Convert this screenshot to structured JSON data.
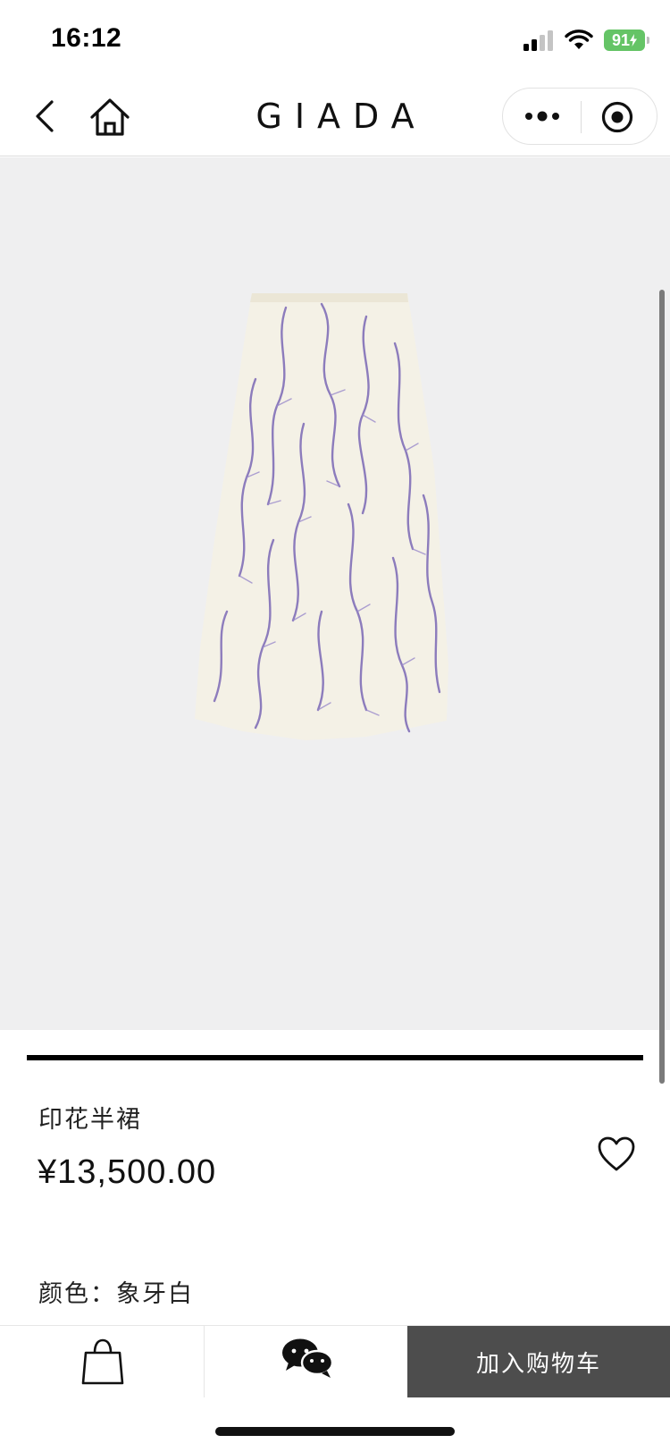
{
  "status_bar": {
    "time": "16:12",
    "battery": "91"
  },
  "nav": {
    "title": "GIADA",
    "back_icon": "chevron-left-icon",
    "home_icon": "home-icon",
    "more_icon": "more-dots-icon",
    "close_icon": "target-close-icon"
  },
  "product": {
    "image_icon": "printed-skirt-image",
    "name": "印花半裙",
    "price": "¥13,500.00",
    "color_label": "颜色：象牙白",
    "favorite_icon": "heart-icon"
  },
  "bottom_bar": {
    "cart_icon": "shopping-bag-icon",
    "chat_icon": "wechat-icon",
    "add_to_cart_label": "加入购物车"
  },
  "colors": {
    "image_background": "#efeff0",
    "add_to_cart_background": "#4d4d4d",
    "battery_green": "#65c466",
    "skirt_fabric": "#f4f1e6",
    "print_purple": "#7b68b5"
  }
}
